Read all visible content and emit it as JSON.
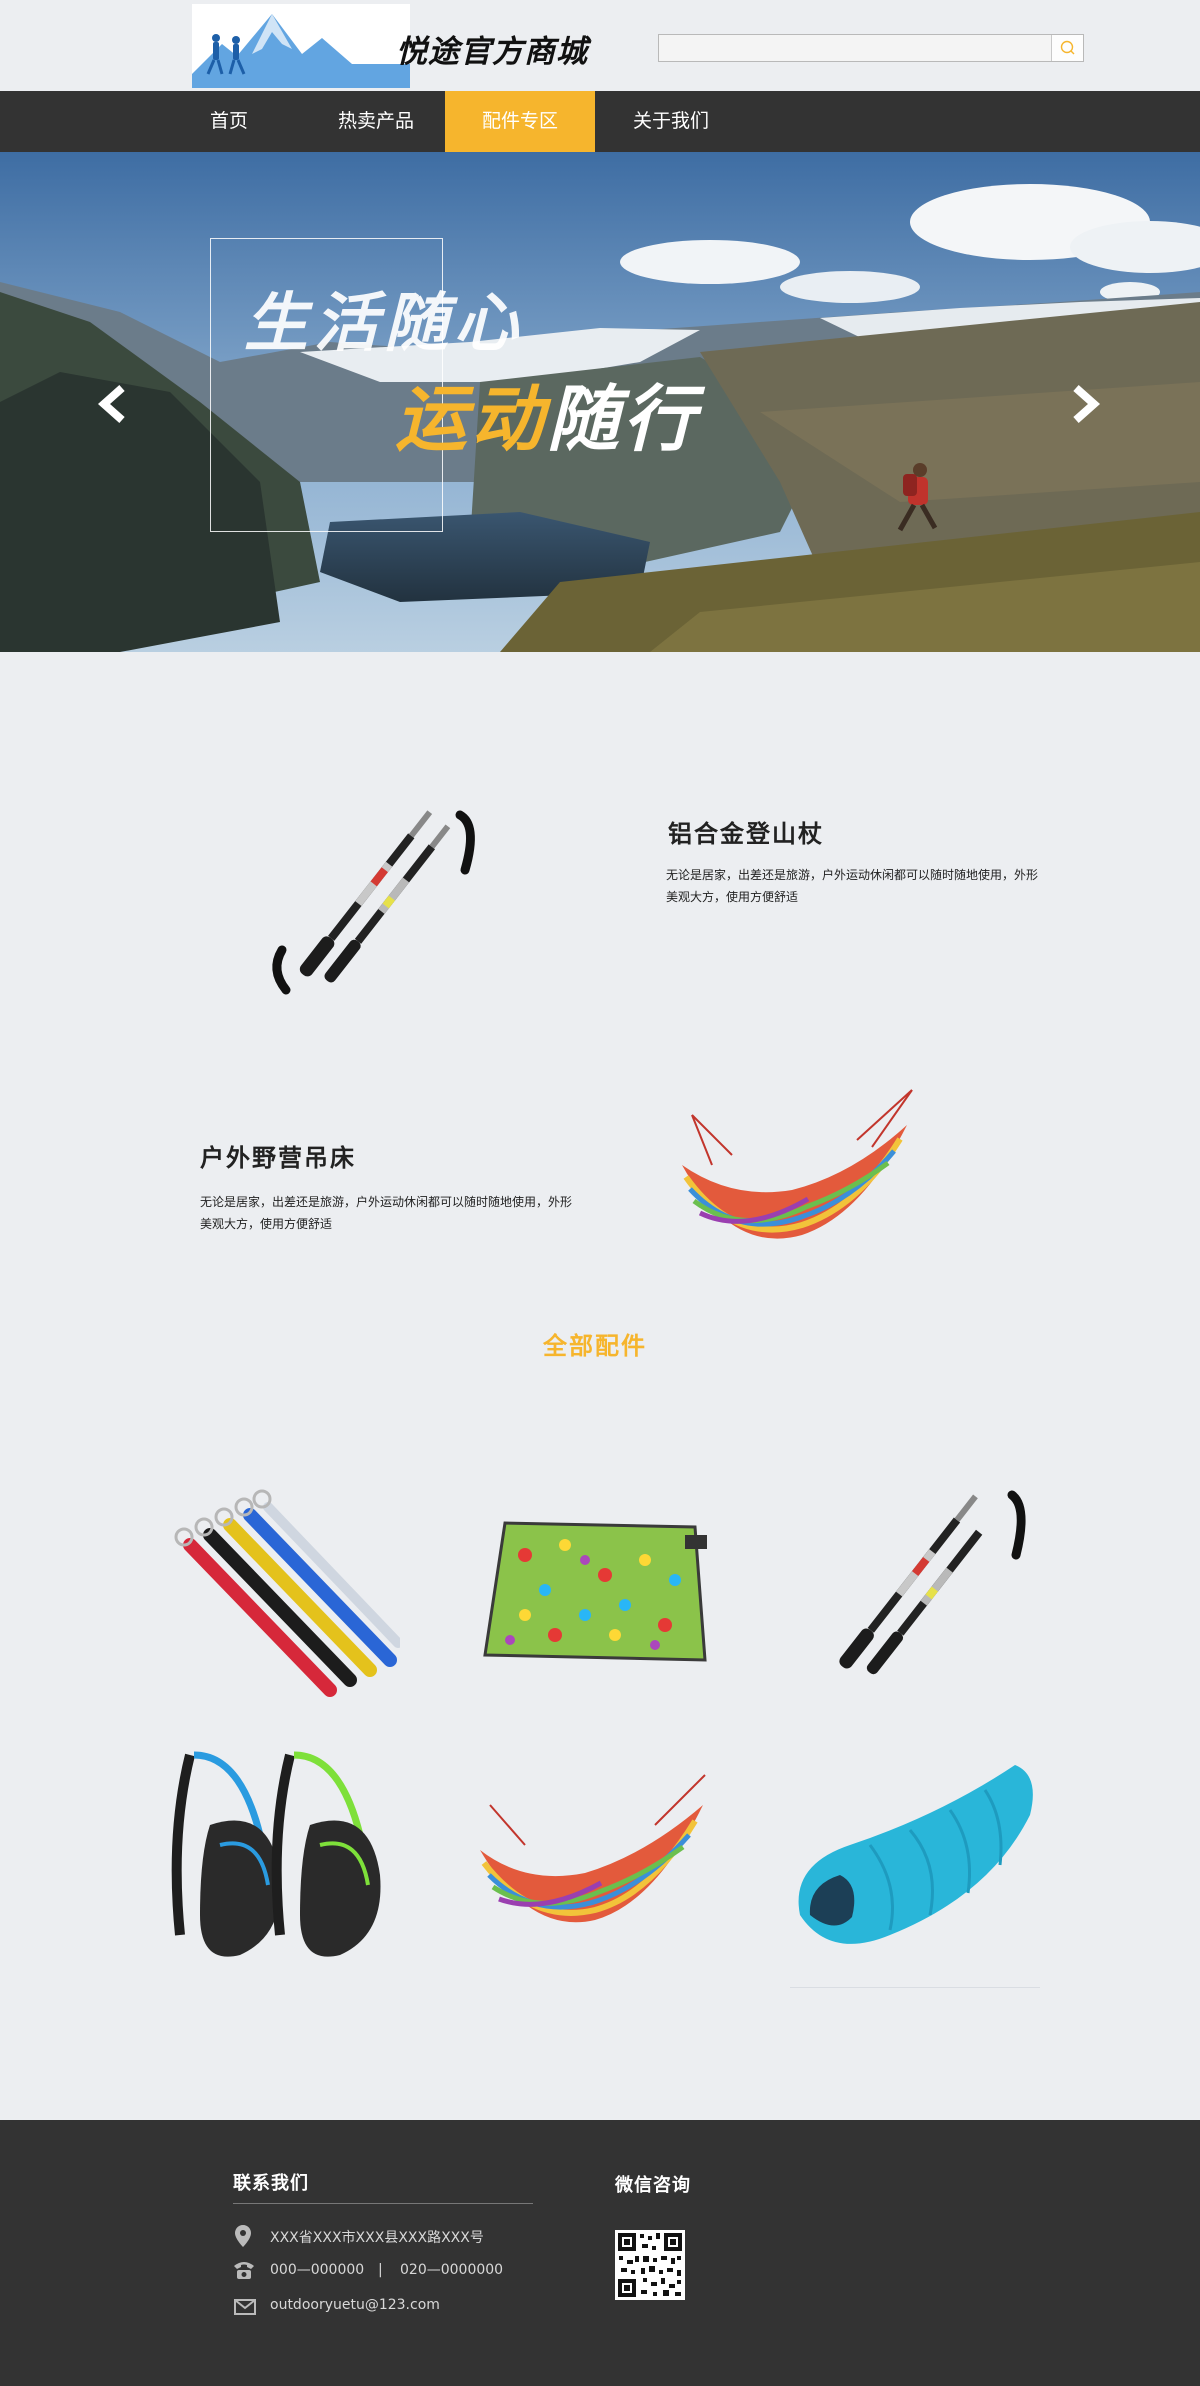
{
  "header": {
    "logo_text": "悦途官方商城",
    "search": {
      "placeholder": "",
      "value": ""
    }
  },
  "nav": {
    "items": [
      {
        "label": "首页"
      },
      {
        "label": "热卖产品"
      },
      {
        "label": "配件专区",
        "active": true
      },
      {
        "label": "关于我们"
      }
    ]
  },
  "banner": {
    "slogan_line1": "生活随心",
    "slogan_line2_accent": "运动",
    "slogan_line2_rest": "随行"
  },
  "featured": [
    {
      "title": "铝合金登山杖",
      "desc": "无论是居家，出差还是旅游，户外运动休闲都可以随时随地使用，外形美观大方，使用方便舒适"
    },
    {
      "title": "户外野营吊床",
      "desc": "无论是居家，出差还是旅游，户外运动休闲都可以随时随地使用，外形美观大方，使用方便舒适"
    }
  ],
  "accessories": {
    "title": "全部配件",
    "items": [
      {
        "icon": "tent-stakes-image"
      },
      {
        "icon": "picnic-mat-image"
      },
      {
        "icon": "trekking-pole-image"
      },
      {
        "icon": "sling-backpack-image"
      },
      {
        "icon": "hammock-image"
      },
      {
        "icon": "sleeping-bag-image"
      }
    ]
  },
  "footer": {
    "contact_title": "联系我们",
    "address": "XXX省XXX市XXX县XXX路XXX号",
    "phone1": "000—000000",
    "separator": "|",
    "phone2": "020—0000000",
    "email": "outdooryuetu@123.com",
    "wechat_title": "微信咨询"
  },
  "colors": {
    "accent": "#f6b52d",
    "dark_bar": "#333333",
    "background": "#eceef1"
  }
}
